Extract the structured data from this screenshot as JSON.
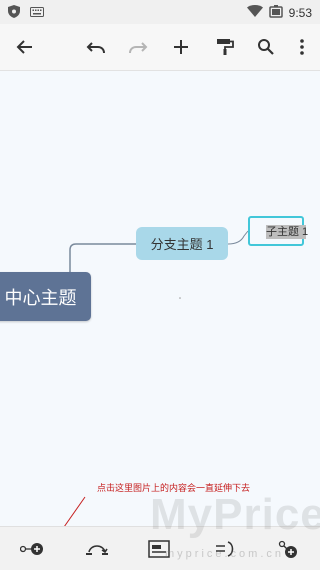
{
  "status_bar": {
    "time": "9:53",
    "icons": [
      "app-shield-icon",
      "keyboard-icon",
      "wifi-icon",
      "battery-icon"
    ]
  },
  "toolbar": {
    "icons": [
      "back-arrow-icon",
      "undo-icon",
      "redo-icon",
      "add-icon",
      "format-paint-icon",
      "search-icon",
      "more-vert-icon"
    ]
  },
  "mindmap": {
    "central_topic": "中心主题",
    "branch_topic": "分支主题 1",
    "sub_topic": "子主题 1",
    "colors": {
      "central": "#5e7395",
      "branch": "#a9d8e9",
      "selection": "#42c7d9"
    }
  },
  "annotation": {
    "text": "点击这里图片上的内容会一直延伸下去",
    "color": "#c62020"
  },
  "bottom_bar": {
    "icons": [
      "add-subtopic-icon",
      "relationship-icon",
      "summary-icon",
      "boundary-icon",
      "add-floating-topic-icon"
    ]
  },
  "watermark": {
    "text": "MyPrice",
    "sub": "myprice.com.cn"
  }
}
